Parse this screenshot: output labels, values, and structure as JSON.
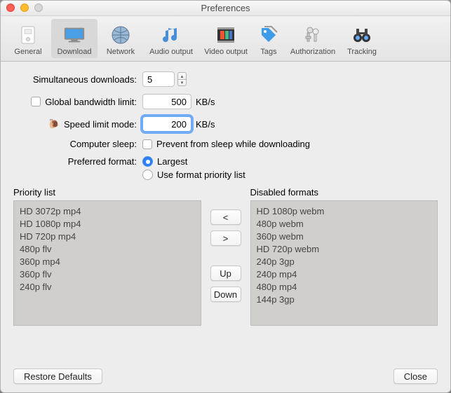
{
  "window": {
    "title": "Preferences"
  },
  "tabs": [
    {
      "label": "General"
    },
    {
      "label": "Download"
    },
    {
      "label": "Network"
    },
    {
      "label": "Audio output"
    },
    {
      "label": "Video output"
    },
    {
      "label": "Tags"
    },
    {
      "label": "Authorization"
    },
    {
      "label": "Tracking"
    }
  ],
  "form": {
    "sim_label": "Simultaneous downloads:",
    "sim_value": "5",
    "gbw_label": "Global bandwidth limit:",
    "gbw_value": "500",
    "kbps": "KB/s",
    "slm_label": "Speed limit mode:",
    "slm_value": "200",
    "cs_label": "Computer sleep:",
    "cs_opt": "Prevent from sleep while downloading",
    "pf_label": "Preferred format:",
    "pf_opt1": "Largest",
    "pf_opt2": "Use format priority list"
  },
  "priority": {
    "title": "Priority list",
    "items": [
      "HD 3072p mp4",
      "HD 1080p mp4",
      "HD 720p mp4",
      "480p flv",
      "360p mp4",
      "360p flv",
      "240p flv"
    ]
  },
  "disabled": {
    "title": "Disabled formats",
    "items": [
      "HD 1080p webm",
      "480p webm",
      "360p webm",
      "HD 720p webm",
      "240p 3gp",
      "240p mp4",
      "480p mp4",
      "144p 3gp"
    ]
  },
  "mid": {
    "left": "<",
    "right": ">",
    "up": "Up",
    "down": "Down"
  },
  "footer": {
    "restore": "Restore Defaults",
    "close": "Close"
  }
}
